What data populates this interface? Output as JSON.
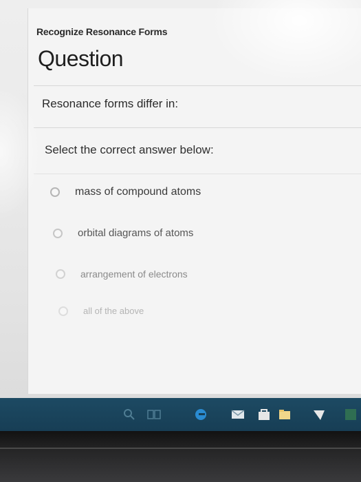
{
  "header": {
    "breadcrumb": "Recognize Resonance Forms",
    "title": "Question"
  },
  "question": {
    "prompt": "Resonance forms differ in:",
    "instruction": "Select the correct answer below:",
    "options": [
      {
        "label": "mass of compound atoms",
        "selected": false
      },
      {
        "label": "orbital diagrams of atoms",
        "selected": false
      },
      {
        "label": "arrangement of electrons",
        "selected": false
      },
      {
        "label": "all of the above",
        "selected": false
      }
    ]
  },
  "colors": {
    "taskbar": "#1d4a63",
    "panel_background": "#f4f4f4",
    "radio_border": "#b5b5b5"
  },
  "taskbar": {
    "icons": [
      "search-icon",
      "task-view-icon",
      "edge-browser-icon",
      "mail-icon",
      "store-icon",
      "file-explorer-icon",
      "app-icon",
      "app-icon"
    ]
  }
}
